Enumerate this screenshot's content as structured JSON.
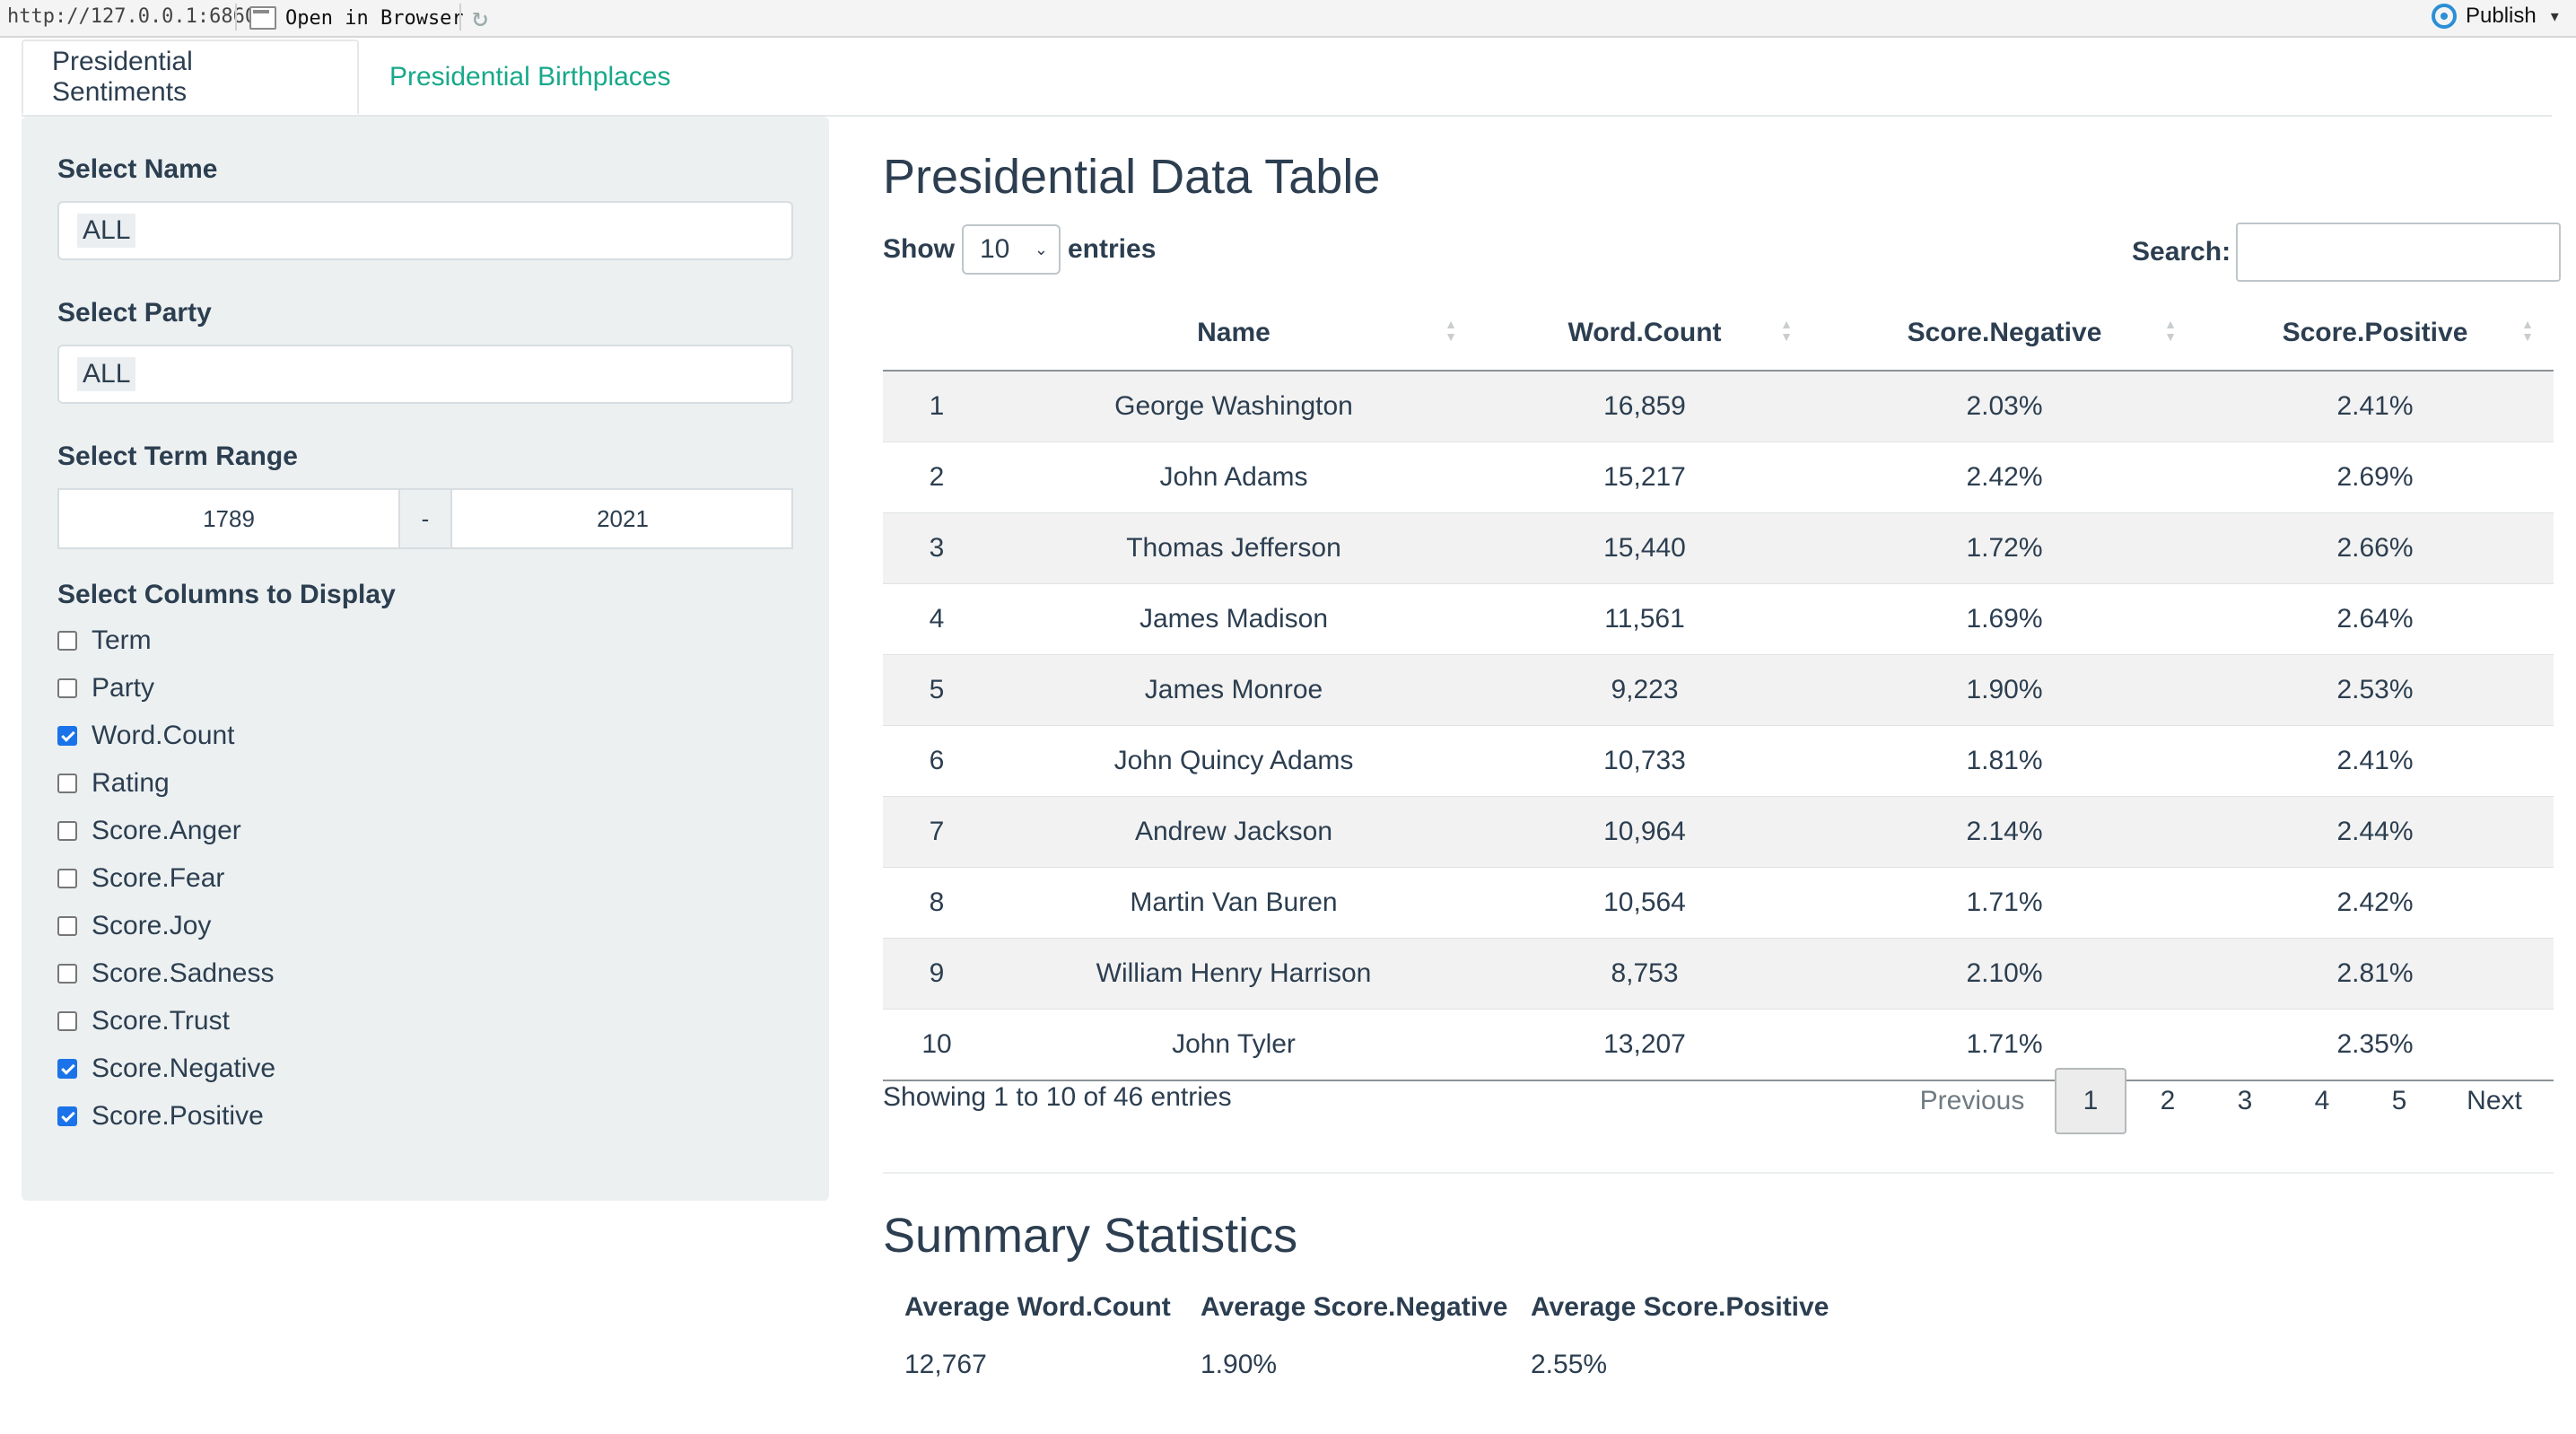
{
  "toolbar": {
    "url": "http://127.0.0.1:6860",
    "open_in_browser": "Open in Browser",
    "publish": "Publish"
  },
  "tabs": [
    {
      "label": "Presidential Sentiments"
    },
    {
      "label": "Presidential Birthplaces"
    }
  ],
  "sidebar": {
    "name_label": "Select Name",
    "name_value": "ALL",
    "party_label": "Select Party",
    "party_value": "ALL",
    "term_label": "Select Term Range",
    "term_start": "1789",
    "term_sep": "-",
    "term_end": "2021",
    "columns_label": "Select Columns to Display",
    "columns": [
      {
        "label": "Term",
        "checked": false
      },
      {
        "label": "Party",
        "checked": false
      },
      {
        "label": "Word.Count",
        "checked": true
      },
      {
        "label": "Rating",
        "checked": false
      },
      {
        "label": "Score.Anger",
        "checked": false
      },
      {
        "label": "Score.Fear",
        "checked": false
      },
      {
        "label": "Score.Joy",
        "checked": false
      },
      {
        "label": "Score.Sadness",
        "checked": false
      },
      {
        "label": "Score.Trust",
        "checked": false
      },
      {
        "label": "Score.Negative",
        "checked": true
      },
      {
        "label": "Score.Positive",
        "checked": true
      }
    ]
  },
  "main": {
    "title": "Presidential Data Table",
    "show_label": "Show",
    "entries_value": "10",
    "entries_label": "entries",
    "search_label": "Search:",
    "search_value": "",
    "headers": [
      "",
      "Name",
      "Word.Count",
      "Score.Negative",
      "Score.Positive"
    ],
    "rows": [
      [
        "1",
        "George Washington",
        "16,859",
        "2.03%",
        "2.41%"
      ],
      [
        "2",
        "John Adams",
        "15,217",
        "2.42%",
        "2.69%"
      ],
      [
        "3",
        "Thomas Jefferson",
        "15,440",
        "1.72%",
        "2.66%"
      ],
      [
        "4",
        "James Madison",
        "11,561",
        "1.69%",
        "2.64%"
      ],
      [
        "5",
        "James Monroe",
        "9,223",
        "1.90%",
        "2.53%"
      ],
      [
        "6",
        "John Quincy Adams",
        "10,733",
        "1.81%",
        "2.41%"
      ],
      [
        "7",
        "Andrew Jackson",
        "10,964",
        "2.14%",
        "2.44%"
      ],
      [
        "8",
        "Martin Van Buren",
        "10,564",
        "1.71%",
        "2.42%"
      ],
      [
        "9",
        "William Henry Harrison",
        "8,753",
        "2.10%",
        "2.81%"
      ],
      [
        "10",
        "John Tyler",
        "13,207",
        "1.71%",
        "2.35%"
      ]
    ],
    "info": "Showing 1 to 10 of 46 entries",
    "pagination": {
      "previous": "Previous",
      "pages": [
        "1",
        "2",
        "3",
        "4",
        "5"
      ],
      "current": "1",
      "next": "Next"
    }
  },
  "summary": {
    "title": "Summary Statistics",
    "headers": [
      "Average Word.Count",
      "Average Score.Negative",
      "Average Score.Positive"
    ],
    "values": [
      "12,767",
      "1.90%",
      "2.55%"
    ]
  },
  "colors": {
    "accent": "#18a88a",
    "text": "#2c3e50",
    "sidebar_bg": "#ecf0f1",
    "checkbox": "#1a73e8"
  },
  "icons": [
    "open-in-browser-icon",
    "refresh-icon",
    "publish-icon",
    "chevron-down-icon",
    "sort-icon"
  ]
}
